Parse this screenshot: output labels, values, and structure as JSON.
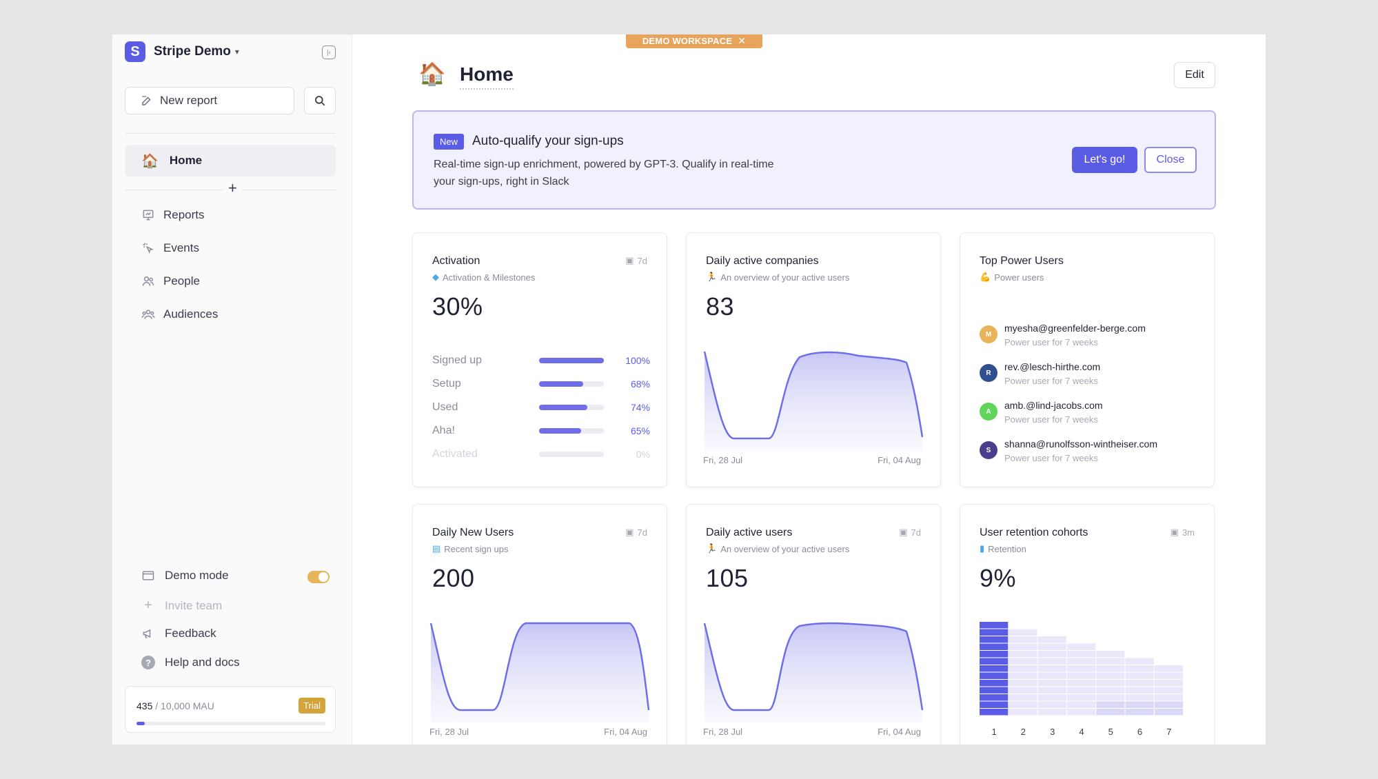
{
  "workspace": {
    "initial": "S",
    "name": "Stripe Demo",
    "color": "#5a5ce6"
  },
  "sidebar": {
    "new_report": "New report",
    "home": "Home",
    "nav": [
      "Reports",
      "Events",
      "People",
      "Audiences"
    ],
    "demo_mode": "Demo mode",
    "demo_mode_on": true,
    "invite_team": "Invite team",
    "feedback": "Feedback",
    "help": "Help and docs",
    "mau_used": "435",
    "mau_total": " / 10,000 MAU",
    "mau_fraction": 0.0435,
    "trial": "Trial"
  },
  "demo_ribbon": "DEMO WORKSPACE",
  "page": {
    "title": "Home",
    "edit": "Edit"
  },
  "banner": {
    "badge": "New",
    "title": "Auto-qualify your sign-ups",
    "desc_1": "Real-time sign-up enrichment, powered by GPT-3. Qualify in real-time",
    "desc_2": "your sign-ups, right in Slack",
    "primary": "Let's go!",
    "secondary": "Close"
  },
  "cards": {
    "activation": {
      "title": "Activation",
      "subtitle": "Activation & Milestones",
      "period": "7d",
      "value": "30%",
      "funnel": [
        {
          "label": "Signed up",
          "pct": "100%",
          "value": 1.0
        },
        {
          "label": "Setup",
          "pct": "68%",
          "value": 0.68
        },
        {
          "label": "Used",
          "pct": "74%",
          "value": 0.74
        },
        {
          "label": "Aha!",
          "pct": "65%",
          "value": 0.65
        },
        {
          "label": "Activated",
          "pct": "0%",
          "value": 0.0
        }
      ]
    },
    "dac": {
      "title": "Daily active companies",
      "subtitle": "An overview of your active users",
      "value": "83",
      "x_start": "Fri, 28 Jul",
      "x_end": "Fri, 04 Aug"
    },
    "power": {
      "title": "Top Power Users",
      "subtitle": "Power users",
      "users": [
        {
          "initial": "M",
          "email": "myesha@greenfelder-berge.com",
          "desc": "Power user for 7 weeks",
          "color": "#e8b45a"
        },
        {
          "initial": "R",
          "email": "rev.@lesch-hirthe.com",
          "desc": "Power user for 7 weeks",
          "color": "#2f4f8f"
        },
        {
          "initial": "A",
          "email": "amb.@lind-jacobs.com",
          "desc": "Power user for 7 weeks",
          "color": "#5fd65a"
        },
        {
          "initial": "S",
          "email": "shanna@runolfsson-wintheiser.com",
          "desc": "Power user for 7 weeks",
          "color": "#4a3f8c"
        }
      ]
    },
    "dnu": {
      "title": "Daily New Users",
      "subtitle": "Recent sign ups",
      "period": "7d",
      "value": "200",
      "x_start": "Fri, 28 Jul",
      "x_end": "Fri, 04 Aug"
    },
    "dau": {
      "title": "Daily active users",
      "subtitle": "An overview of your active users",
      "period": "7d",
      "value": "105",
      "x_start": "Fri, 28 Jul",
      "x_end": "Fri, 04 Aug"
    },
    "retention": {
      "title": "User retention cohorts",
      "subtitle": "Retention",
      "period": "3m",
      "value": "9%",
      "x": [
        "1",
        "2",
        "3",
        "4",
        "5",
        "6",
        "7"
      ]
    }
  }
}
